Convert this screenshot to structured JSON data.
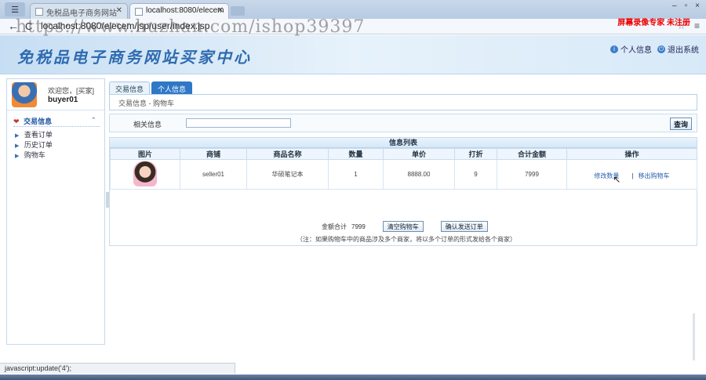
{
  "browser": {
    "tabs": [
      {
        "title": "免税品电子商务网站"
      },
      {
        "title": "localhost:8080/elecem"
      }
    ],
    "url": "localhost:8080/elecem/jsp/user/index.jsp",
    "watermark": "https://www.huzhan.com/ishop39397",
    "recorder_label": "屏幕录像专家 未注册",
    "status_text": "javascript:update('4');",
    "window_controls": [
      "–",
      "▫",
      "×"
    ]
  },
  "site": {
    "title": "免税品电子商务网站买家中心",
    "top_links": [
      {
        "label": "个人信息",
        "icon": "user-info-icon"
      },
      {
        "label": "退出系统",
        "icon": "logout-icon"
      }
    ]
  },
  "sidebar": {
    "welcome": "欢迎您，[买家]",
    "username": "buyer01",
    "menu_title": "交易信息",
    "items": [
      {
        "label": "查看订单"
      },
      {
        "label": "历史订单"
      },
      {
        "label": "购物车"
      }
    ]
  },
  "main": {
    "tabs": [
      {
        "label": "交易信息",
        "active": false
      },
      {
        "label": "个人信息",
        "active": true
      }
    ],
    "breadcrumb": "交易信息 - 购物车",
    "search": {
      "label": "相关信息",
      "value": "",
      "button": "查询"
    },
    "list": {
      "caption": "信息列表",
      "columns": [
        "图片",
        "商铺",
        "商品名称",
        "数量",
        "单价",
        "打折",
        "合计金额",
        "操作"
      ],
      "rows": [
        {
          "shop": "seller01",
          "product": "华硕笔记本",
          "quantity": "1",
          "price": "8888.00",
          "discount": "9",
          "total": "7999",
          "actions": [
            "修改数量",
            "移出购物车"
          ]
        }
      ]
    },
    "summary": {
      "total_label": "金额合计",
      "total_value": "7999",
      "clear_button": "清空购物车",
      "confirm_button": "确认发送订单",
      "note": "（注：如果购物车中的商品涉及多个商家，将以多个订单的形式发给各个商家）"
    }
  }
}
